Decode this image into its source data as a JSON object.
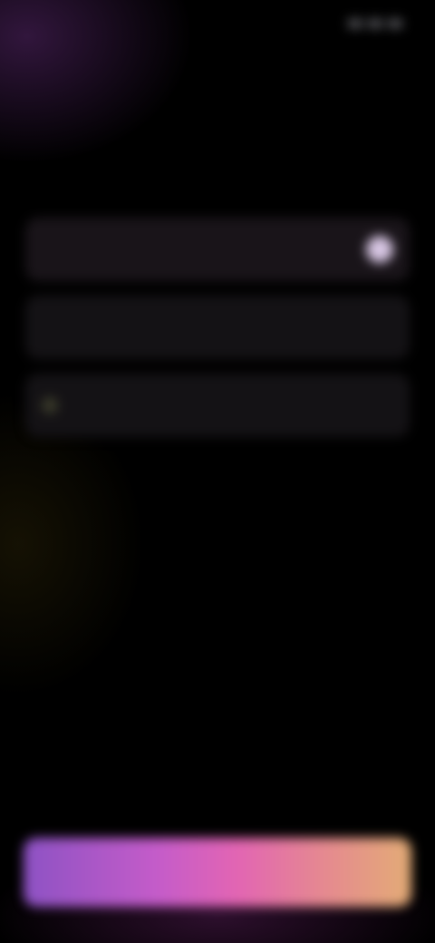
{
  "status_bar": {
    "time": "",
    "icons": [
      "signal-icon",
      "wifi-icon",
      "battery-icon"
    ]
  },
  "nav": {
    "back_label": ""
  },
  "header": {
    "title": "",
    "subtitle": ""
  },
  "options": [
    {
      "label": "",
      "selected": true
    },
    {
      "label": "",
      "selected": false
    },
    {
      "label": "",
      "selected": false
    }
  ],
  "cta": {
    "label": ""
  },
  "colors": {
    "accent_purple": "#8d52c4",
    "accent_pink": "#e265b3",
    "accent_peach": "#e3ac76",
    "selected_radio": "#d7c6e3",
    "background": "#000000"
  }
}
